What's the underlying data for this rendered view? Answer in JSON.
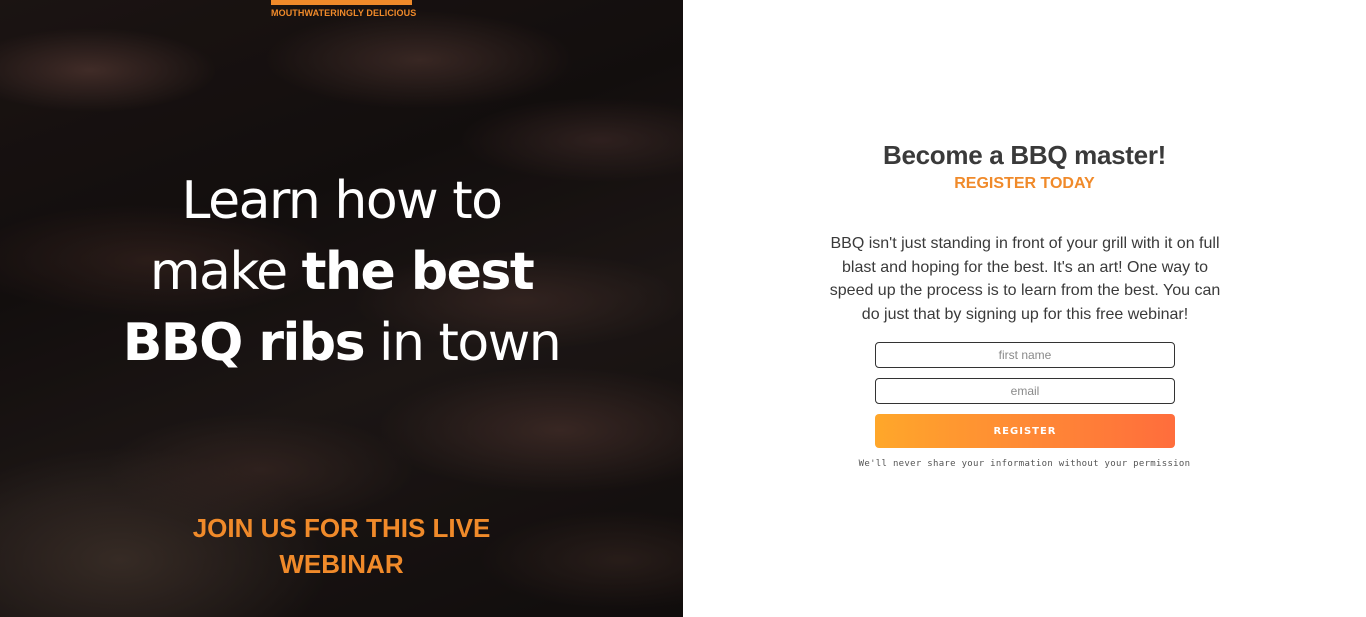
{
  "hero": {
    "tagline": "MOUTHWATERINGLY DELICIOUS",
    "headline": {
      "line1": "Learn how to",
      "line2_light": "make ",
      "line2_bold": "the best",
      "line3_bold": "BBQ ribs",
      "line3_light": " in town"
    },
    "webinar_line1": "JOIN US FOR THIS LIVE",
    "webinar_line2": "WEBINAR"
  },
  "form_panel": {
    "title": "Become a BBQ master!",
    "subtitle": "REGISTER TODAY",
    "description": "BBQ isn't just standing in front of your grill with it on full blast and hoping for the best. It's an art! One way to speed up the process is to learn from the best. You can do just that by signing up for this free webinar!",
    "first_name_placeholder": "first name",
    "email_placeholder": "email",
    "register_label": "REGISTER",
    "privacy_note": "We'll never share your information without your permission"
  },
  "colors": {
    "accent": "#f08a2a",
    "button_gradient_start": "#ffa72a",
    "button_gradient_end": "#ff6d3c",
    "text_dark": "#3a3a3a"
  }
}
